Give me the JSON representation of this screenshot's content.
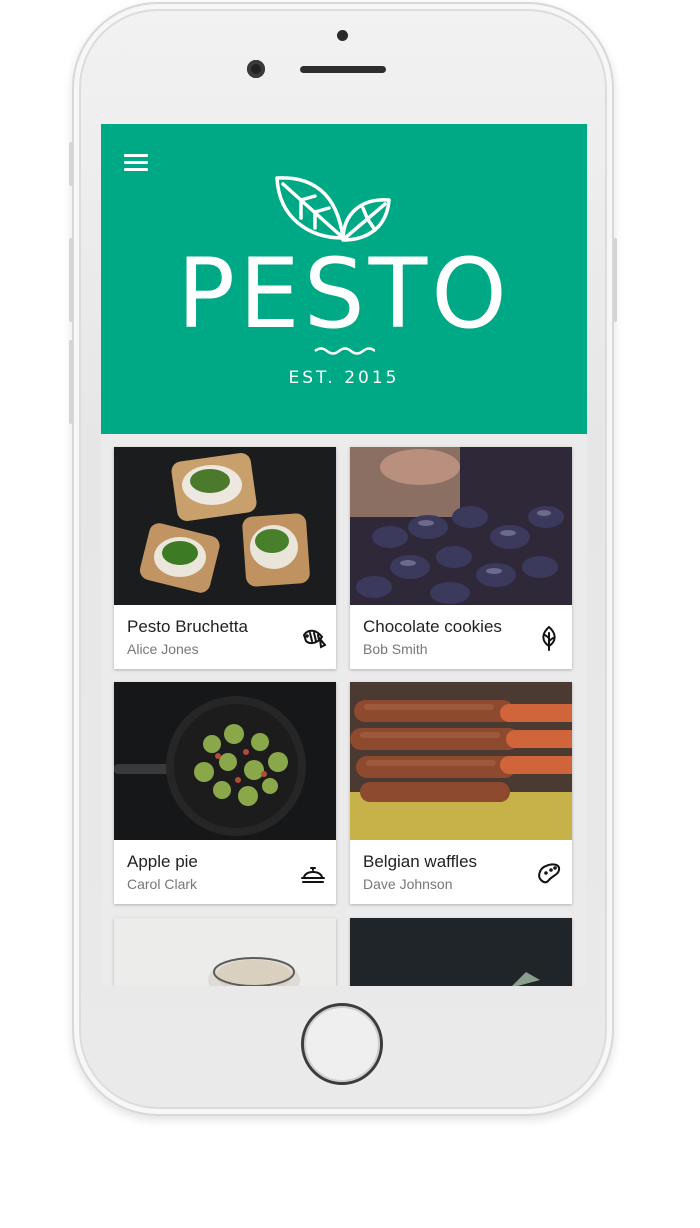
{
  "header": {
    "brand": "PESTO",
    "established": "EST. 2015",
    "color": "#00a985"
  },
  "recipes": [
    {
      "title": "Pesto Bruchetta",
      "author": "Alice Jones",
      "icon": "fish-icon"
    },
    {
      "title": "Chocolate cookies",
      "author": "Bob Smith",
      "icon": "leaf-icon"
    },
    {
      "title": "Apple pie",
      "author": "Carol Clark",
      "icon": "cloche-icon"
    },
    {
      "title": "Belgian waffles",
      "author": "Dave Johnson",
      "icon": "potato-icon"
    }
  ]
}
